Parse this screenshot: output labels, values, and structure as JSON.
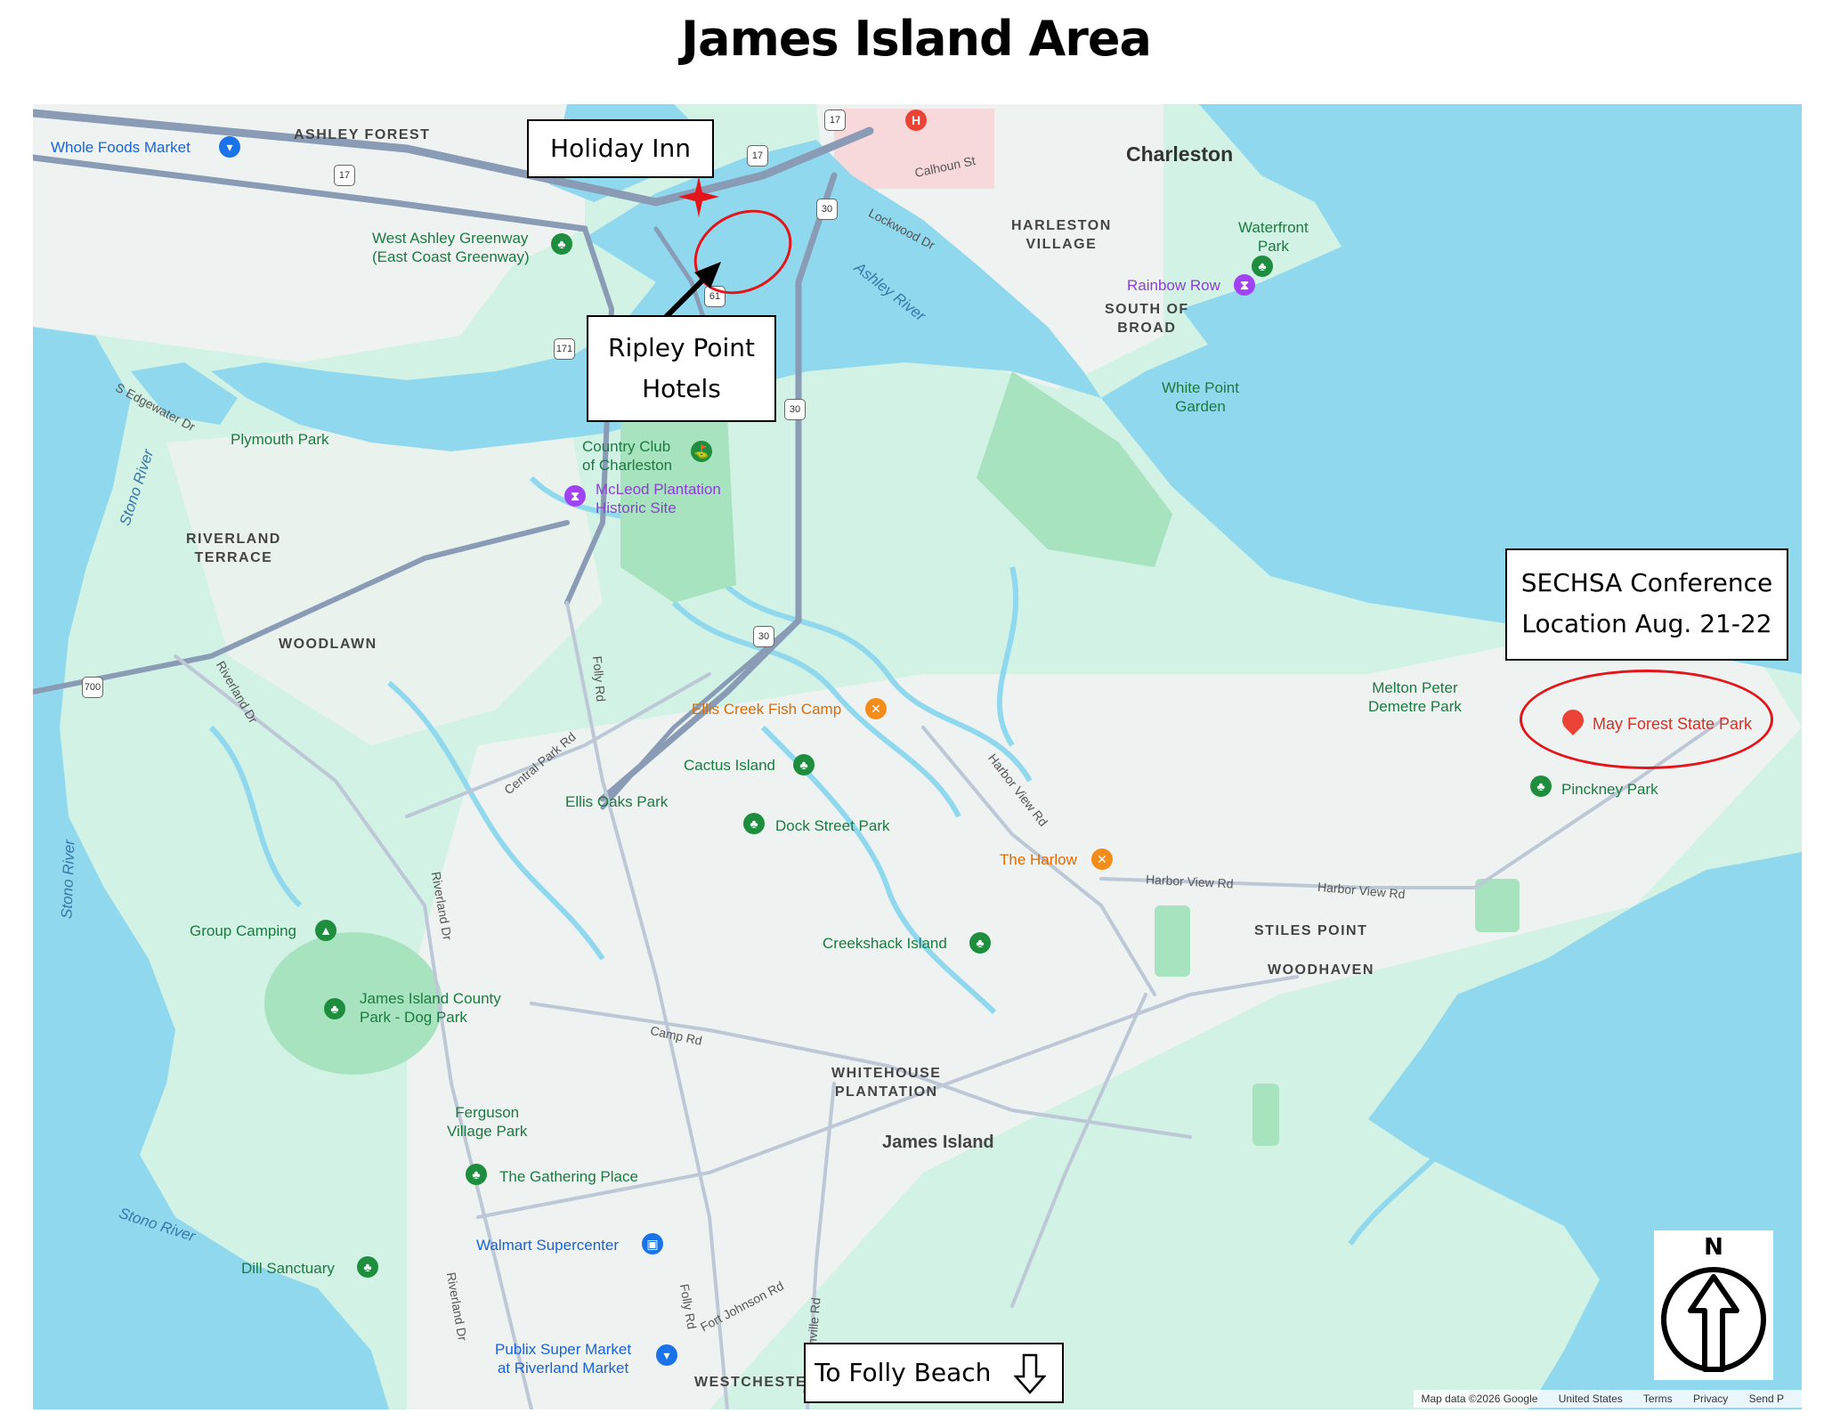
{
  "title": "James Island Area",
  "callouts": {
    "holiday_inn": "Holiday Inn",
    "ripley_line1": "Ripley Point",
    "ripley_line2": "Hotels",
    "sechsa_line1": "SECHSA Conference",
    "sechsa_line2": "Location Aug. 21-22",
    "folly": "To Folly Beach"
  },
  "compass": {
    "letter": "N"
  },
  "labels": {
    "ashley_forest": "ASHLEY FOREST",
    "whole_foods": "Whole Foods Market",
    "charleston": "Charleston",
    "harleston1": "HARLESTON",
    "harleston2": "VILLAGE",
    "south_broad1": "SOUTH OF",
    "south_broad2": "BROAD",
    "waterfront1": "Waterfront",
    "waterfront2": "Park",
    "rainbow_row": "Rainbow Row",
    "white_point1": "White Point",
    "white_point2": "Garden",
    "greenway1": "West Ashley Greenway",
    "greenway2": "(East Coast Greenway)",
    "plymouth": "Plymouth Park",
    "riverland_terrace1": "RIVERLAND",
    "riverland_terrace2": "TERRACE",
    "country_club1": "Country Club",
    "country_club2": "of Charleston",
    "mcleod1": "McLeod Plantation",
    "mcleod2": "Historic Site",
    "woodlawn": "WOODLAWN",
    "ellis_creek": "Ellis Creek Fish Camp",
    "cactus": "Cactus Island",
    "ellis_oaks": "Ellis Oaks Park",
    "dock_street": "Dock Street Park",
    "melton1": "Melton Peter",
    "melton2": "Demetre Park",
    "may_forest": "May Forest State Park",
    "pinckney": "Pinckney Park",
    "harlow": "The Harlow",
    "stiles_point": "STILES POINT",
    "woodhaven": "WOODHAVEN",
    "group_camping": "Group Camping",
    "creekshack": "Creekshack Island",
    "county_park1": "James Island County",
    "county_park2": "Park - Dog Park",
    "whitehouse1": "WHITEHOUSE",
    "whitehouse2": "PLANTATION",
    "james_island": "James Island",
    "ferguson1": "Ferguson",
    "ferguson2": "Village Park",
    "gathering": "The Gathering Place",
    "walmart": "Walmart Supercenter",
    "dill": "Dill Sanctuary",
    "publix1": "Publix Super Market",
    "publix2": "at Riverland Market",
    "westchester": "WESTCHESTER",
    "ashley_river": "Ashley River",
    "stono_river_a": "Stono River",
    "stono_river_b": "Stono River",
    "stono_river_c": "Stono River"
  },
  "roads": {
    "edgewater": "S Edgewater Dr",
    "riverland_dr_a": "Riverland Dr",
    "riverland_dr_b": "Riverland Dr",
    "riverland_dr_c": "Riverland Dr",
    "central_park": "Central Park Rd",
    "folly_rd_a": "Folly Rd",
    "folly_rd_b": "Folly Rd",
    "harbor_view_a": "Harbor View Rd",
    "harbor_view_b": "Harbor View Rd",
    "harbor_view_c": "Harbor View Rd",
    "camp_rd": "Camp Rd",
    "fort_johnson": "Fort Johnson Rd",
    "secessionville": "Secessionville Rd",
    "calhoun": "Calhoun St",
    "lockwood": "Lockwood Dr"
  },
  "shields": {
    "r17a": "17",
    "r17b": "17",
    "r17c": "17",
    "r30a": "30",
    "r30b": "30",
    "r30c": "30",
    "r61": "61",
    "r171": "171",
    "r700": "700"
  },
  "footer": {
    "map_data": "Map data ©2026 Google",
    "region": "United States",
    "terms": "Terms",
    "privacy": "Privacy",
    "send": "Send P"
  },
  "colors": {
    "water": "#8fd8ed",
    "land": "#d1f2e4",
    "park": "#a8e3bf",
    "callout_ellipse": "#e3151a"
  }
}
